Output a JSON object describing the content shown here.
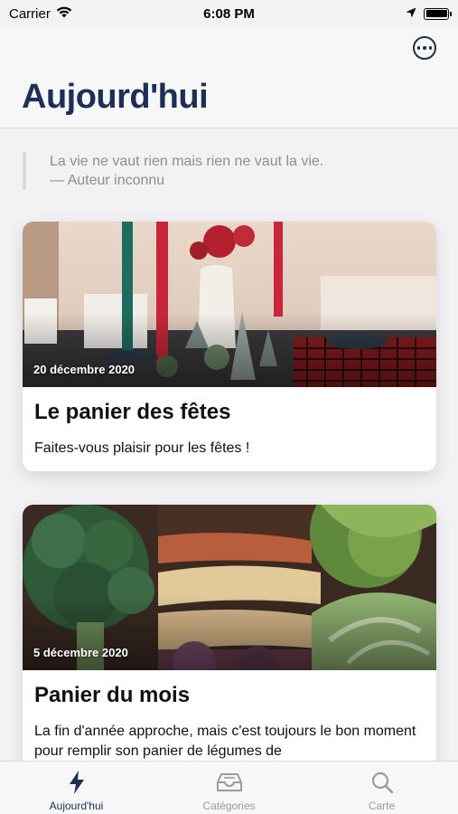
{
  "status_bar": {
    "carrier": "Carrier",
    "time": "6:08 PM"
  },
  "header": {
    "title": "Aujourd'hui",
    "more_icon": "ellipsis-circle-icon"
  },
  "quote": {
    "text": "La vie ne vaut rien mais rien ne vaut la vie.",
    "author": "— Auteur inconnu"
  },
  "cards": [
    {
      "date": "20 décembre 2020",
      "title": "Le panier des fêtes",
      "description": "Faites-vous plaisir pour les fêtes !",
      "image": "holiday-table-photo"
    },
    {
      "date": "5 décembre 2020",
      "title": "Panier du mois",
      "description": "La fin d'année approche, mais c'est toujours le bon moment pour remplir son panier de légumes de",
      "image": "vegetables-photo"
    }
  ],
  "tabs": [
    {
      "label": "Aujourd'hui",
      "icon": "bolt-icon",
      "active": true
    },
    {
      "label": "Catégories",
      "icon": "tray-icon",
      "active": false
    },
    {
      "label": "Carte",
      "icon": "search-icon",
      "active": false
    }
  ],
  "colors": {
    "accent": "#1e2f57",
    "inactive": "#9a9aa0",
    "background": "#f2f2f4"
  }
}
